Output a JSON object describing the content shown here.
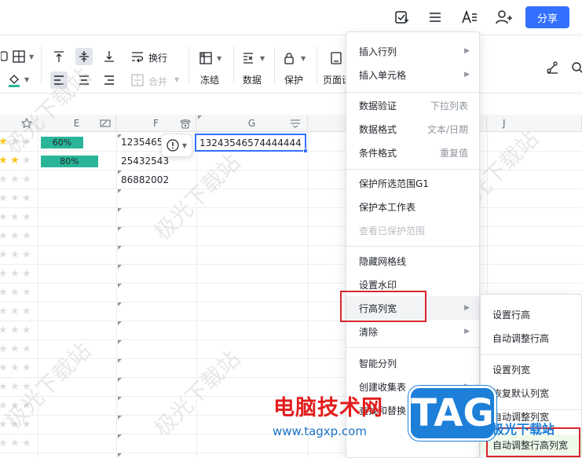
{
  "topbar": {
    "share_label": "分享",
    "icons": [
      "doc-check-icon",
      "menu-icon",
      "text-style-icon",
      "add-user-icon"
    ]
  },
  "toolbar": {
    "wrap_label": "换行",
    "merge_label": "合并",
    "freeze_label": "冻结",
    "data_label": "数据",
    "protect_label": "保护",
    "page_label": "页面设"
  },
  "grid": {
    "columns": [
      "E",
      "F",
      "G",
      "J"
    ],
    "rows": [
      {
        "stars": 3,
        "progress_text": "60%",
        "progress": 0.6,
        "phone": "1235465",
        "g": "13243546574444444"
      },
      {
        "stars": 4,
        "progress_text": "80%",
        "progress": 0.8,
        "phone": "25432543",
        "g": ""
      },
      {
        "stars": 1,
        "progress_text": "",
        "progress": 0,
        "phone": "86882002",
        "g": ""
      },
      {
        "stars": 2,
        "progress_text": "",
        "progress": 0,
        "phone": "",
        "g": ""
      }
    ],
    "watermark": "极光下载站"
  },
  "context_menu": {
    "items": [
      {
        "label": "插入行列",
        "arrow": true
      },
      {
        "label": "插入单元格",
        "arrow": true
      },
      {
        "label": "数据验证",
        "shortcut": "下拉列表"
      },
      {
        "label": "数据格式",
        "shortcut": "文本/日期"
      },
      {
        "label": "条件格式",
        "shortcut": "重复值"
      },
      {
        "label": "保护所选范围G1"
      },
      {
        "label": "保护本工作表"
      },
      {
        "label": "查看已保护范围",
        "disabled": true
      },
      {
        "label": "隐藏网格线"
      },
      {
        "label": "设置水印"
      },
      {
        "label": "行高列宽",
        "arrow": true,
        "highlight": true
      },
      {
        "label": "清除",
        "arrow": true
      },
      {
        "label": "智能分列"
      },
      {
        "label": "创建收集表",
        "arrow": true
      },
      {
        "label": "查找和替换"
      }
    ]
  },
  "submenu": {
    "items": [
      "设置行高",
      "自动调整行高",
      "设置列宽",
      "恢复默认列宽",
      "自动调整列宽",
      "自动调整行高列宽"
    ]
  },
  "logo": {
    "cn": "电脑技术网",
    "url": "www.tagxp.com",
    "tag": "TAG",
    "sub": "极光下载站"
  },
  "colors": {
    "accent": "#3370ff",
    "progress": "#2ab598",
    "star": "#f8c51c",
    "highlight_box": "#d7262c"
  }
}
